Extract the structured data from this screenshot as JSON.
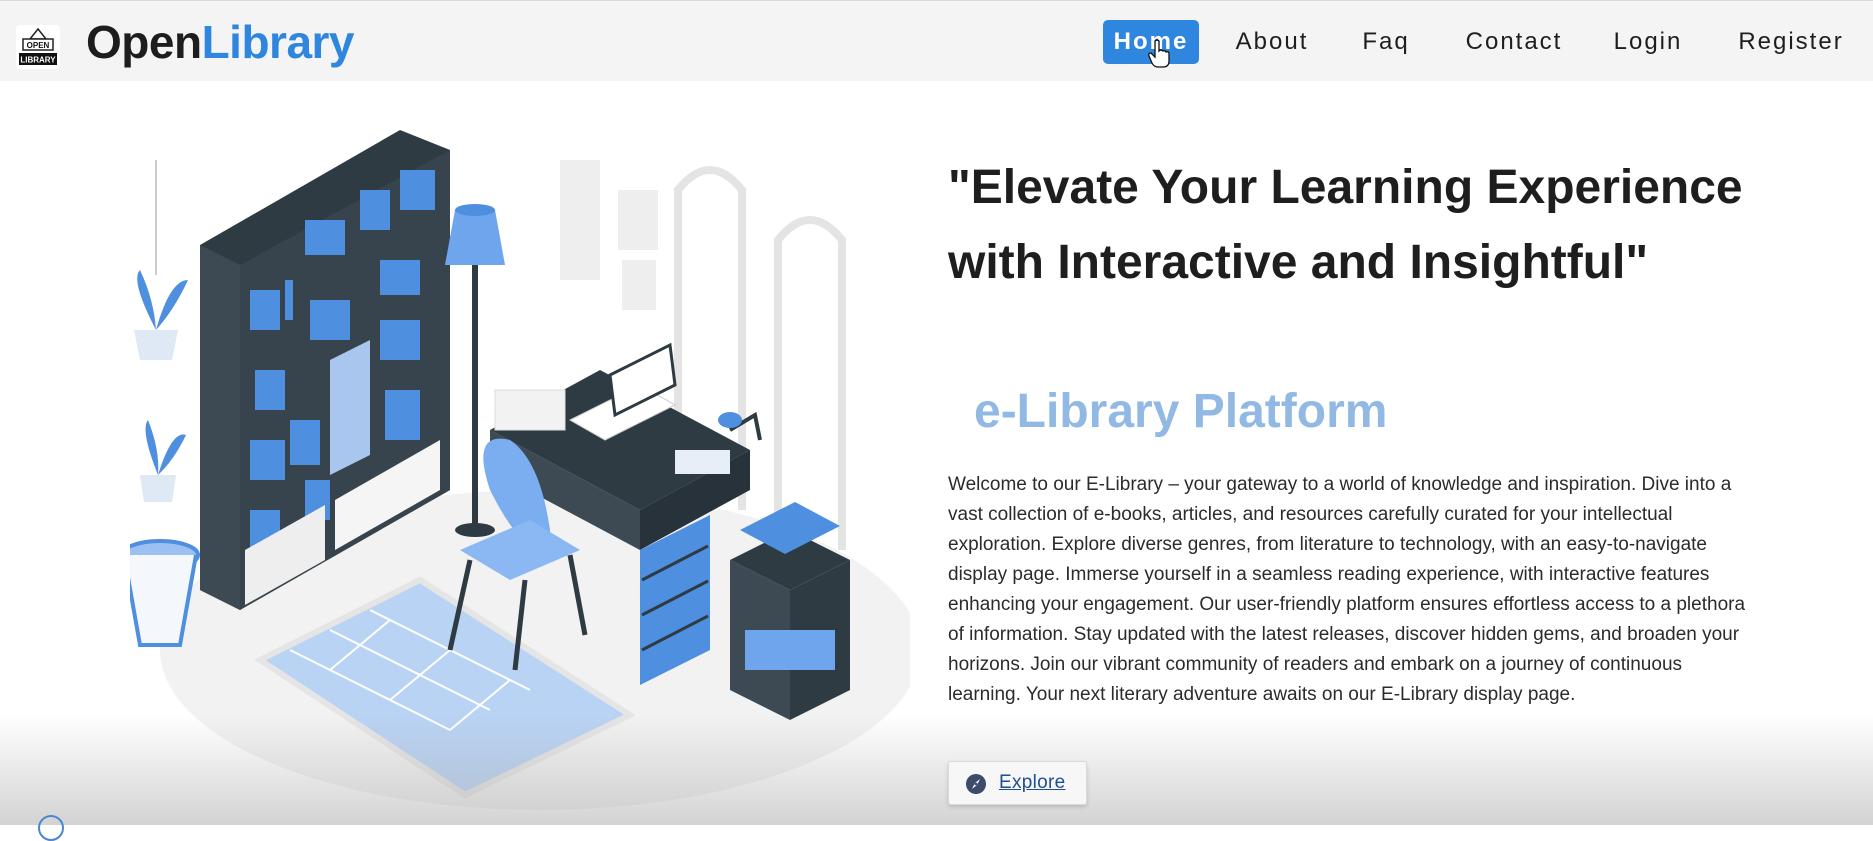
{
  "header": {
    "logo_text_top": "OPEN",
    "logo_text_bottom": "LIBRARY",
    "brand_part1": "Open",
    "brand_part2": "Library",
    "nav": [
      {
        "label": "Home",
        "active": true
      },
      {
        "label": "About"
      },
      {
        "label": "Faq"
      },
      {
        "label": "Contact"
      },
      {
        "label": "Login"
      },
      {
        "label": "Register"
      }
    ]
  },
  "hero": {
    "title": "\"Elevate Your Learning Experience with Interactive and Insightful\"",
    "subtitle": "e-Library Platform",
    "description": "Welcome to our E-Library – your gateway to a world of knowledge and inspiration. Dive into a vast collection of e-books, articles, and resources carefully curated for your intellectual exploration. Explore diverse genres, from literature to technology, with an easy-to-navigate display page. Immerse yourself in a seamless reading experience, with interactive features enhancing your engagement. Our user-friendly platform ensures effortless access to a plethora of information. Stay updated with the latest releases, discover hidden gems, and broaden your horizons. Join our vibrant community of readers and embark on a journey of continuous learning. Your next literary adventure awaits on our E-Library display page.",
    "explore_label": "Explore"
  },
  "colors": {
    "accent": "#2f86de",
    "subtitle": "#92b9e3",
    "header_bg": "#f4f4f4"
  }
}
